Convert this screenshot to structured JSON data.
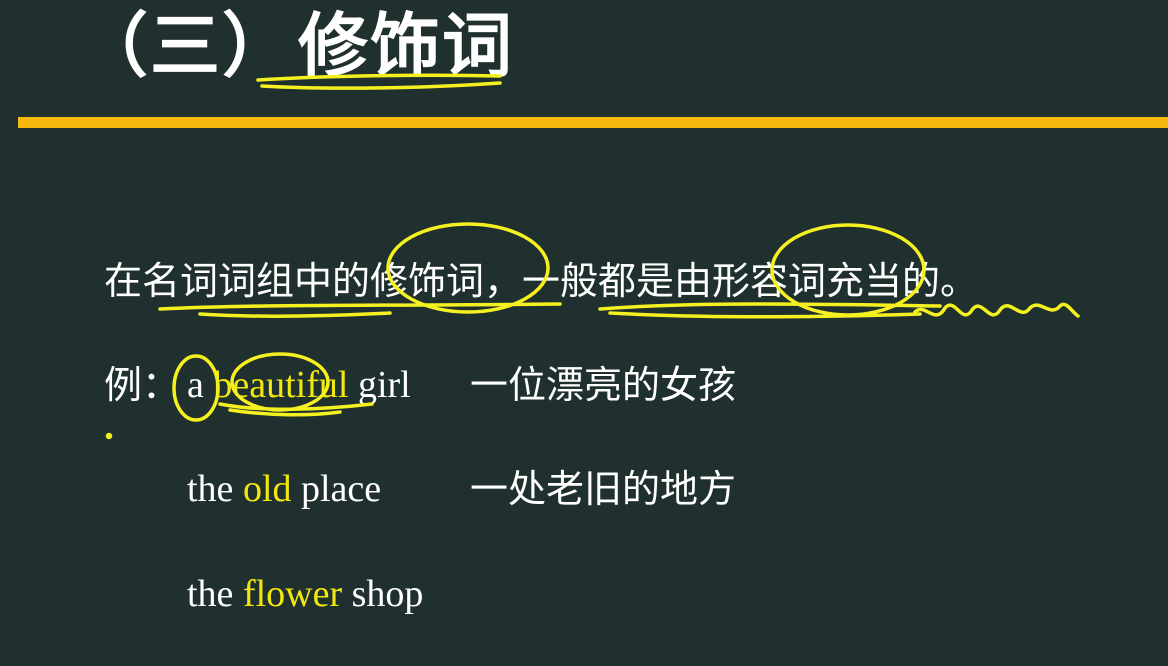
{
  "title": {
    "number": "（三）",
    "text": "修饰词"
  },
  "definition": "在名词词组中的修饰词，一般都是由形容词充当的。",
  "example_label": "例：",
  "examples": [
    {
      "before": "a ",
      "highlight": "beautiful",
      "after": " girl",
      "translation": "一位漂亮的女孩"
    },
    {
      "before": "the ",
      "highlight": "old",
      "after": " place",
      "translation": "一处老旧的地方"
    },
    {
      "before": "the ",
      "highlight": "flower",
      "after": " shop",
      "translation": ""
    }
  ],
  "colors": {
    "background": "#1f302f",
    "accent_bar": "#f4b80f",
    "highlight": "#f2e70f",
    "annotation": "#f5f020"
  }
}
